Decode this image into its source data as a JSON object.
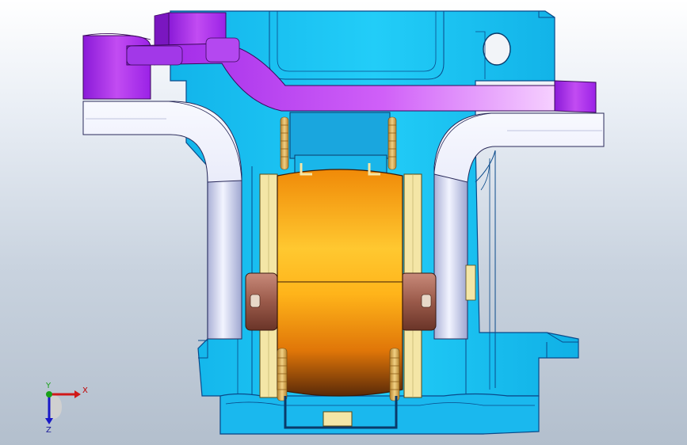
{
  "viewport": {
    "background_top": "#ffffff",
    "background_bottom": "#b3bfcd"
  },
  "model": {
    "colors": {
      "housing": "#1ec8f5",
      "housing_edge": "#0a4a8a",
      "bracket": "#b23cf0",
      "tube": "#d8dcf2",
      "rotor": "#f59a0a",
      "plate": "#f4e6a6",
      "spring": "#d8a24a",
      "pin": "#b06a5a"
    }
  },
  "triad": {
    "x_label": "X",
    "y_label": "Y",
    "z_label": "Z",
    "x_color": "#d01818",
    "y_color": "#18a018",
    "z_color": "#1818c8"
  }
}
